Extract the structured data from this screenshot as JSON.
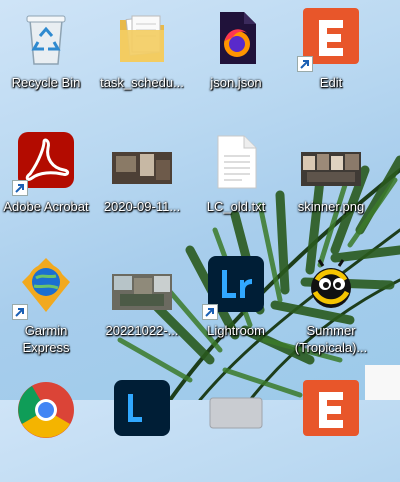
{
  "desktop": {
    "icons": [
      {
        "id": "recycle",
        "label": "Recycle Bin",
        "icon": "recycle-bin-icon"
      },
      {
        "id": "task",
        "label": "task_schedu...",
        "icon": "folder-icon"
      },
      {
        "id": "json",
        "label": "json.json",
        "icon": "firefox-icon"
      },
      {
        "id": "edit",
        "label": "Edit",
        "icon": "edit-app-icon"
      },
      {
        "id": "acrobat",
        "label": "Adobe Acrobat",
        "icon": "adobe-acrobat-icon"
      },
      {
        "id": "photo2020",
        "label": "2020-09-11...",
        "icon": "image-thumbnail-icon"
      },
      {
        "id": "lcold",
        "label": "LC_old.txt",
        "icon": "text-file-icon"
      },
      {
        "id": "skinner",
        "label": "skinner.png",
        "icon": "image-thumbnail-icon"
      },
      {
        "id": "garmin",
        "label": "Garmin Express",
        "icon": "garmin-express-icon"
      },
      {
        "id": "photo2022",
        "label": "20221022-...",
        "icon": "image-thumbnail-icon"
      },
      {
        "id": "lightroom",
        "label": "Lightroom",
        "icon": "lightroom-icon"
      },
      {
        "id": "summer",
        "label": "Summer (Tropicala)...",
        "icon": "bee-icon"
      }
    ],
    "partial_icons": [
      "chrome-icon",
      "lightroom-classic-icon",
      "drive-icon",
      "edit-app-icon"
    ],
    "colors": {
      "acrobat": "#b30b00",
      "edit": "#e8562a",
      "lightroom": "#001e36",
      "lightroom_accent": "#31a8ff"
    }
  }
}
